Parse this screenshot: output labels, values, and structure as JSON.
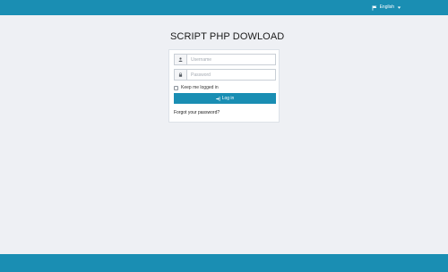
{
  "colors": {
    "brand": "#1a8eb3",
    "page_background": "#eef0f4",
    "panel_background": "#ffffff"
  },
  "header": {
    "language_label": "English",
    "language_icon": "flag-icon",
    "dropdown_icon": "caret-down-icon"
  },
  "login": {
    "title": "SCRIPT PHP DOWLOAD",
    "username": {
      "placeholder": "Username",
      "value": "",
      "icon": "user-icon"
    },
    "password": {
      "placeholder": "Password",
      "value": "",
      "icon": "lock-icon"
    },
    "remember_label": "Keep me logged in",
    "remember_checked": false,
    "submit_label": "Log in",
    "submit_icon": "sign-in-icon",
    "forgot_link": "Forgot your password?"
  }
}
